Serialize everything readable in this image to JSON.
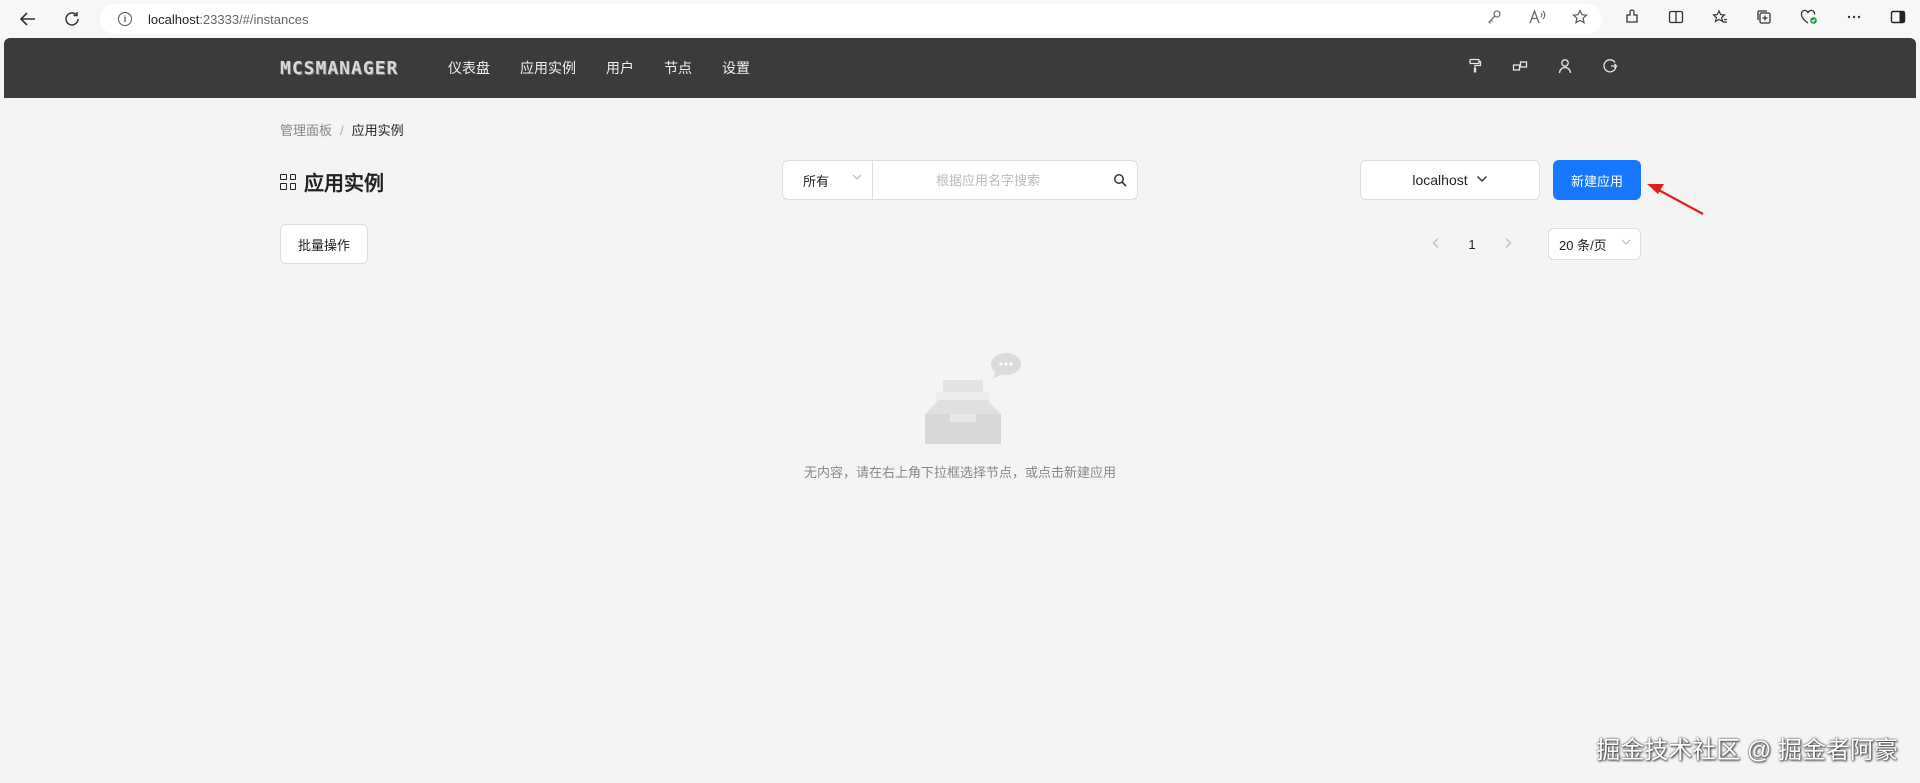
{
  "browser": {
    "url_host": "localhost",
    "url_rest": ":23333/#/instances"
  },
  "header": {
    "logo": "MCSMANAGER",
    "nav": [
      "仪表盘",
      "应用实例",
      "用户",
      "节点",
      "设置"
    ]
  },
  "breadcrumb": {
    "root": "管理面板",
    "separator": "/",
    "current": "应用实例"
  },
  "page": {
    "title": "应用实例",
    "filter_value": "所有",
    "search_placeholder": "根据应用名字搜索",
    "node_value": "localhost",
    "create_label": "新建应用",
    "batch_label": "批量操作",
    "current_page": "1",
    "page_size": "20 条/页",
    "empty_text": "无内容，请在右上角下拉框选择节点，或点击新建应用"
  },
  "watermark": "掘金技术社区 @ 掘金者阿豪",
  "colors": {
    "primary": "#1677ff",
    "header_bg": "#3b3b3b",
    "annotation_arrow": "#e02020"
  }
}
